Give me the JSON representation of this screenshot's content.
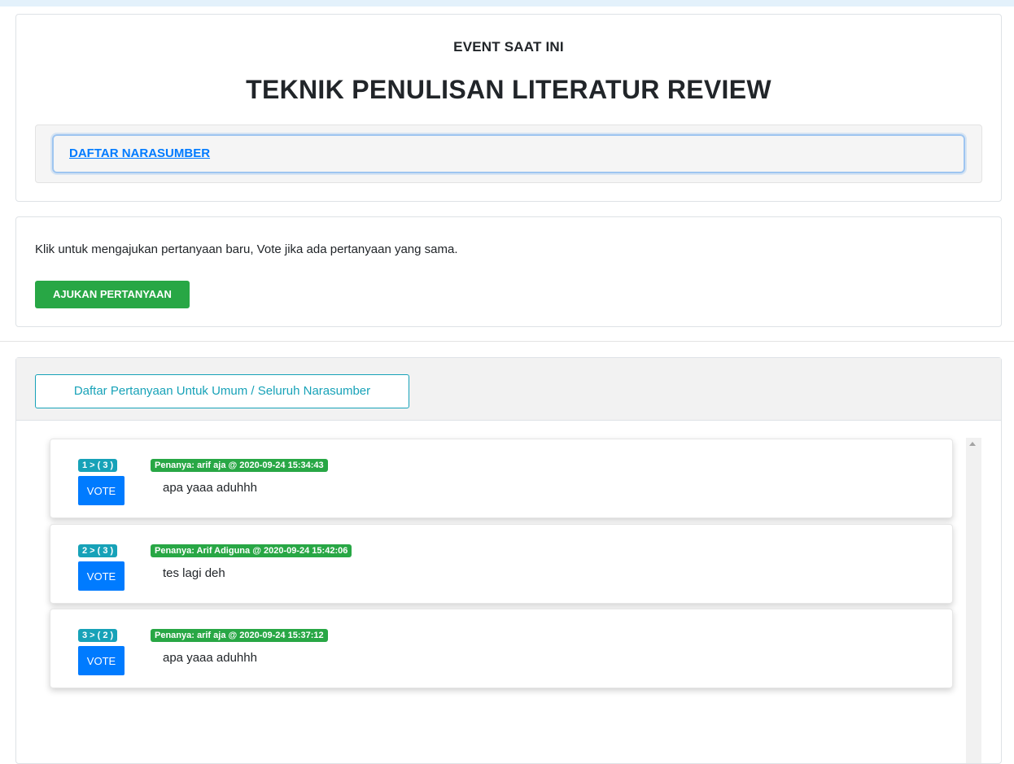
{
  "event": {
    "label": "EVENT SAAT INI",
    "title": "TEKNIK PENULISAN LITERATUR REVIEW",
    "speakers_link": "DAFTAR NARASUMBER"
  },
  "ask": {
    "instruction": "Klik untuk mengajukan pertanyaan baru, Vote jika ada pertanyaan yang sama.",
    "button_label": "AJUKAN PERTANYAAN"
  },
  "questions_panel": {
    "tab_label": "Daftar Pertanyaan Untuk Umum / Seluruh Narasumber",
    "vote_label": "VOTE",
    "questions": [
      {
        "rank": "1 > ( 3 )",
        "asker": "Penanya: arif aja @ 2020-09-24 15:34:43",
        "text": "apa yaaa aduhhh"
      },
      {
        "rank": "2 > ( 3 )",
        "asker": "Penanya: Arif Adiguna @ 2020-09-24 15:42:06",
        "text": "tes lagi deh"
      },
      {
        "rank": "3 > ( 2 )",
        "asker": "Penanya: arif aja @ 2020-09-24 15:37:12",
        "text": "apa yaaa aduhhh"
      }
    ]
  },
  "colors": {
    "primary": "#007bff",
    "success": "#28a745",
    "info": "#17a2b8"
  },
  "icons": {
    "scroll_up": "scroll-up-arrow-icon"
  }
}
